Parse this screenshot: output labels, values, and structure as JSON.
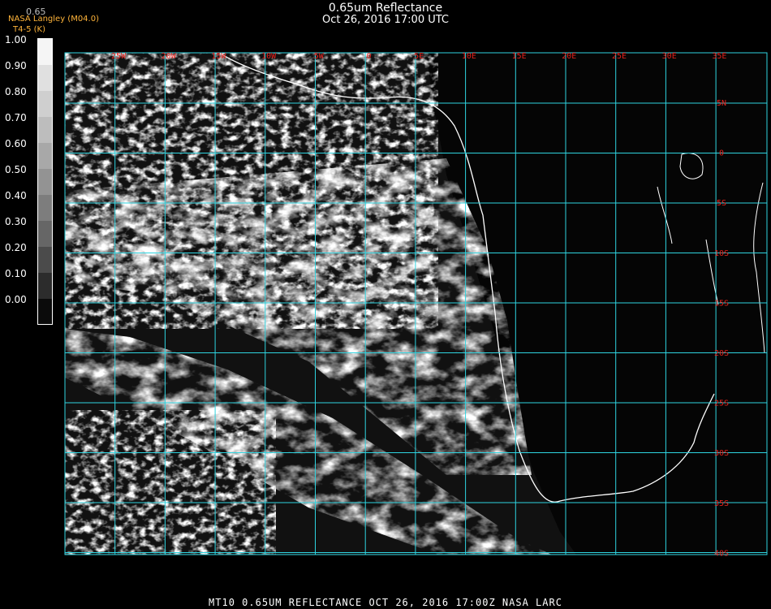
{
  "title": "0.65um Reflectance",
  "subtitle": "Oct 26, 2016 17:00 UTC",
  "provider": "NASA Langley (M04.0)",
  "channel_value": "0.65",
  "bt_label": "T4-5 (K)",
  "colorbar": {
    "ticks": [
      "1.00",
      "0.90",
      "0.80",
      "0.70",
      "0.60",
      "0.50",
      "0.40",
      "0.30",
      "0.20",
      "0.10",
      "0.00"
    ]
  },
  "grid": {
    "longitudes": [
      "25W",
      "20W",
      "15W",
      "10W",
      "5W",
      "0",
      "5E",
      "10E",
      "15E",
      "20E",
      "25E",
      "30E",
      "35E"
    ],
    "latitudes": [
      "5N",
      "0",
      "5S",
      "10S",
      "15S",
      "20S",
      "25S",
      "30S",
      "35S",
      "40S"
    ],
    "line_color": "#2fd4e0",
    "label_color": "#e8211c"
  },
  "footer": "MT10  0.65UM REFLECTANCE   OCT 26, 2016 17:00Z   NASA LARC"
}
